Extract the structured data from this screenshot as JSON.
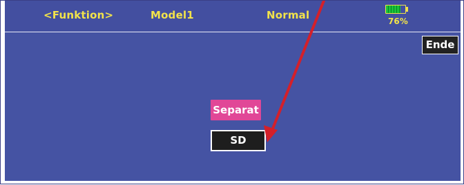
{
  "header": {
    "function_label": "<Funktion>",
    "model_name": "Model1",
    "mode": "Normal",
    "battery": {
      "percent_text": "76%",
      "level": 0.76,
      "color": "#18c43b"
    }
  },
  "buttons": {
    "end_label": "Ende",
    "separat_label": "Separat",
    "sd_label": "SD"
  },
  "colors": {
    "background": "#4553a3",
    "header_text": "#f2e34a",
    "separat": "#e14797",
    "button_dark": "#1e1e1e",
    "arrow": "#d4202a"
  },
  "annotation": {
    "icon": "red-arrow-icon"
  }
}
